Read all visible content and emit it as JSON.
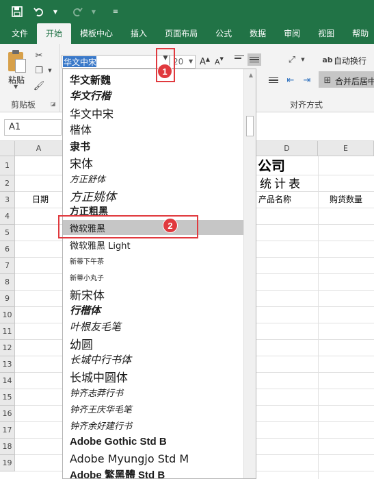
{
  "quick_access": {
    "save_icon": "save-icon",
    "undo_icon": "undo-icon",
    "redo_icon": "redo-icon",
    "customize_icon": "customize-icon"
  },
  "tabs": [
    {
      "label": "文件"
    },
    {
      "label": "开始"
    },
    {
      "label": "模板中心"
    },
    {
      "label": "插入"
    },
    {
      "label": "页面布局"
    },
    {
      "label": "公式"
    },
    {
      "label": "数据"
    },
    {
      "label": "审阅"
    },
    {
      "label": "视图"
    },
    {
      "label": "帮助"
    }
  ],
  "ribbon": {
    "paste_label": "粘贴",
    "clipboard_label": "剪贴板",
    "font_value": "华文中宋",
    "font_size": "20",
    "grow_label": "A",
    "shrink_label": "A",
    "wrap_text": "自动换行",
    "merge_center": "合并后居中",
    "alignment_label": "对齐方式"
  },
  "namebox": {
    "value": "A1"
  },
  "grid": {
    "columns": [
      "A",
      "D",
      "E"
    ],
    "rows": [
      "1",
      "2",
      "3",
      "4",
      "5",
      "6",
      "7",
      "8",
      "9",
      "10",
      "11",
      "12",
      "13",
      "14",
      "15",
      "16",
      "17",
      "18",
      "19"
    ],
    "cells": {
      "title_fragment": "公司",
      "subtitle_fragment": "统计表",
      "a3": "日期",
      "d3": "产品名称",
      "e3": "购货数量"
    }
  },
  "font_list": [
    "华文新魏",
    "华文行楷",
    "华文中宋",
    "楷体",
    "隶书",
    "宋体",
    "方正舒体",
    "方正姚体",
    "方正粗黑",
    "微软雅黑",
    "微软雅黑 Light",
    "新蒂下午茶",
    "新蒂小丸子",
    "新宋体",
    "行楷体",
    "叶根友毛笔",
    "幼圆",
    "长城中行书体",
    "长城中圆体",
    "钟齐志莽行书",
    "钟齐王庆华毛笔",
    "钟齐余好建行书",
    "Adobe Gothic Std B",
    "Adobe Myungjo Std M",
    "Adobe 繁黑體 Std B"
  ],
  "badges": {
    "one": "1",
    "two": "2"
  },
  "colors": {
    "accent": "#217346",
    "highlight": "#e0393e",
    "selection": "#3a79c9"
  }
}
